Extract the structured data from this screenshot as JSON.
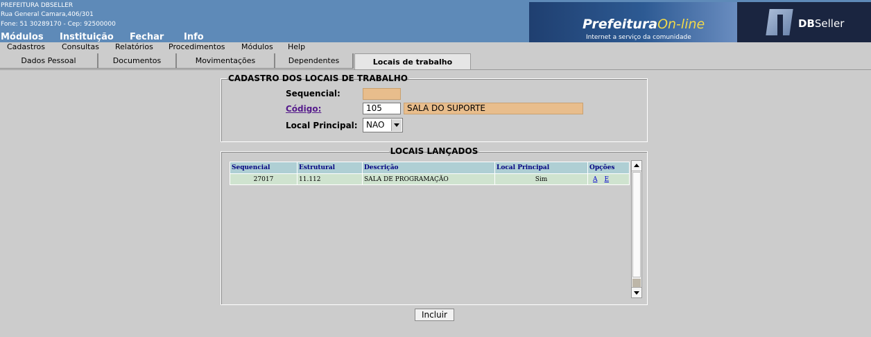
{
  "header": {
    "org_name": "PREFEITURA DBSELLER",
    "address": "Rua General Camara,406/301",
    "phone_line": "Fone: 51 30289170  -  Cep: 92500000",
    "menu": [
      "Módulos",
      "Instituição",
      "Fechar",
      "Info"
    ],
    "banner_title_a": "Prefeitura",
    "banner_title_b": "On-line",
    "banner_tagline": "Internet a serviço da comunidade",
    "brand_a": "DB",
    "brand_b": "Seller"
  },
  "menubar": [
    "Cadastros",
    "Consultas",
    "Relatórios",
    "Procedimentos",
    "Módulos",
    "Help"
  ],
  "tabs": [
    "Dados Pessoal",
    "Documentos",
    "Movimentações",
    "Dependentes",
    "Locais de trabalho"
  ],
  "form": {
    "legend": "CADASTRO DOS LOCAIS DE TRABALHO",
    "sequencial_label": "Sequencial:",
    "sequencial_value": "",
    "codigo_label": "Código:",
    "codigo_value": "105",
    "codigo_desc": "SALA DO SUPORTE",
    "local_principal_label": "Local Principal:",
    "local_principal_value": "NAO"
  },
  "list": {
    "legend": "LOCAIS LANÇADOS",
    "columns": [
      "Sequencial",
      "Estrutural",
      "Descrição",
      "Local Principal",
      "Opções"
    ],
    "rows": [
      {
        "sequencial": "27017",
        "estrutural": "11.112",
        "descricao": "SALA DE PROGRAMAÇÃO",
        "local_principal": "Sim",
        "opt_a": "A",
        "opt_e": "E"
      }
    ]
  },
  "actions": {
    "incluir": "Incluir"
  },
  "colors": {
    "header_bg": "#5e8ab8",
    "readonly_bg": "#e8bd8c",
    "grid_header_bg": "#afcfd4",
    "grid_row_bg": "#cfe3cf"
  }
}
